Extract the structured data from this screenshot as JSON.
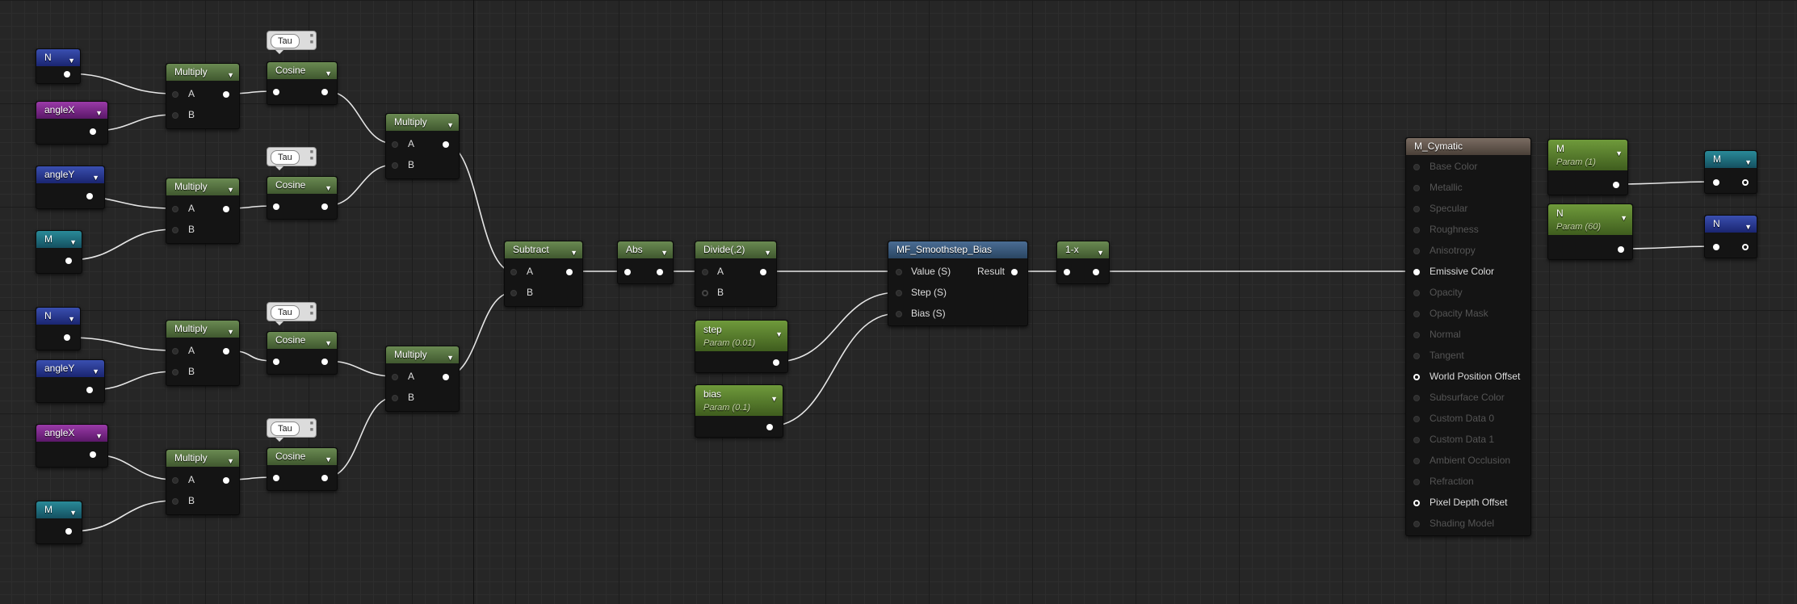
{
  "nodes": {
    "n1": {
      "title": "N"
    },
    "anglex1": {
      "title": "angleX"
    },
    "angley1": {
      "title": "angleY"
    },
    "m1": {
      "title": "M"
    },
    "n2": {
      "title": "N"
    },
    "angley2": {
      "title": "angleY"
    },
    "anglex2": {
      "title": "angleX"
    },
    "m2": {
      "title": "M"
    },
    "mult": {
      "title": "Multiply",
      "pin_a": "A",
      "pin_b": "B"
    },
    "cosine": {
      "title": "Cosine"
    },
    "tau": "Tau",
    "subtract": {
      "title": "Subtract",
      "pin_a": "A",
      "pin_b": "B"
    },
    "abs": {
      "title": "Abs"
    },
    "divide": {
      "title": "Divide(,2)",
      "pin_a": "A",
      "pin_b": "B"
    },
    "step": {
      "title": "step",
      "sub": "Param (0.01)"
    },
    "bias": {
      "title": "bias",
      "sub": "Param (0.1)"
    },
    "smoothstep": {
      "title": "MF_Smoothstep_Bias",
      "in1": "Value (S)",
      "in2": "Step (S)",
      "in3": "Bias (S)",
      "out": "Result"
    },
    "oneminus": {
      "title": "1-x"
    },
    "paramM": {
      "title": "M",
      "sub": "Param (1)"
    },
    "paramN": {
      "title": "N",
      "sub": "Param (60)"
    },
    "rerouteM": {
      "title": "M"
    },
    "rerouteN": {
      "title": "N"
    }
  },
  "material": {
    "title": "M_Cymatic",
    "inputs": [
      {
        "label": "Base Color",
        "active": false
      },
      {
        "label": "Metallic",
        "active": false
      },
      {
        "label": "Specular",
        "active": false
      },
      {
        "label": "Roughness",
        "active": false
      },
      {
        "label": "Anisotropy",
        "active": false
      },
      {
        "label": "Emissive Color",
        "active": true
      },
      {
        "label": "Opacity",
        "active": false
      },
      {
        "label": "Opacity Mask",
        "active": false
      },
      {
        "label": "Normal",
        "active": false
      },
      {
        "label": "Tangent",
        "active": false
      },
      {
        "label": "World Position Offset",
        "active": true
      },
      {
        "label": "Subsurface Color",
        "active": false
      },
      {
        "label": "Custom Data 0",
        "active": false
      },
      {
        "label": "Custom Data 1",
        "active": false
      },
      {
        "label": "Ambient Occlusion",
        "active": false
      },
      {
        "label": "Refraction",
        "active": false
      },
      {
        "label": "Pixel Depth Offset",
        "active": true
      },
      {
        "label": "Shading Model",
        "active": false
      }
    ]
  },
  "colors": {
    "material_expression": "#5b7a47",
    "parameter": "#5a8a30",
    "vector_blue": "#2a3a9a",
    "vector_purple": "#7a2a8a",
    "vector_teal": "#206878",
    "function_call": "#3b5b80",
    "result_node": "#6a5e56"
  }
}
